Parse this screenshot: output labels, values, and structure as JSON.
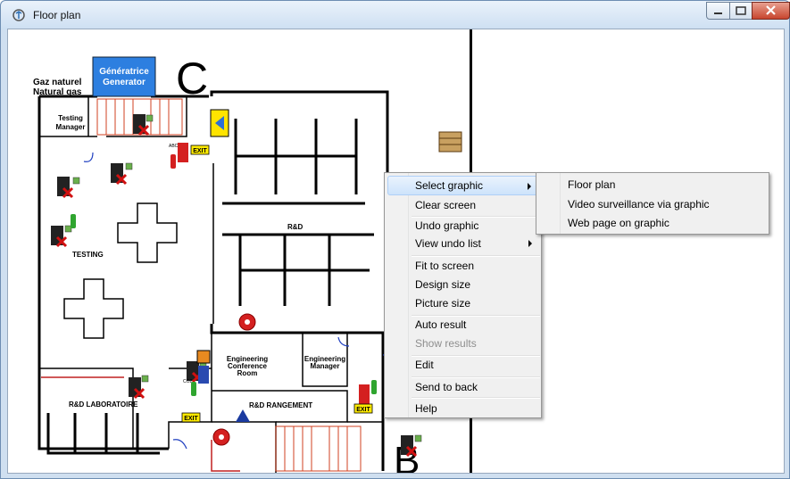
{
  "window": {
    "title": "Floor plan"
  },
  "floorplan": {
    "gas_label": "Gaz naturel",
    "gas_label_en": "Natural gas",
    "generator_fr": "Génératrice",
    "generator_en": "Generator",
    "building_c": "C",
    "building_b": "B",
    "testing_manager_1": "Testing",
    "testing_manager_2": "Manager",
    "testing": "TESTING",
    "rnd": "R&D",
    "eng_conf_1": "Engineering",
    "eng_conf_2": "Conference",
    "eng_conf_3": "Room",
    "eng_mgr_1": "Engineering",
    "eng_mgr_2": "Manager",
    "rnd_lab": "R&D LABORATOIRE",
    "rnd_rangement": "R&D RANGEMENT",
    "exit": "EXIT",
    "abc": "ABC",
    "co2": "CO2"
  },
  "context_menu": {
    "items": [
      {
        "label": "Select graphic",
        "submenu": true,
        "highlighted": true,
        "enabled": true
      },
      {
        "label": "Clear screen",
        "enabled": true
      },
      {
        "label": "Undo graphic",
        "enabled": true
      },
      {
        "label": "View undo list",
        "submenu": true,
        "enabled": true
      },
      {
        "label": "Fit to screen",
        "enabled": true
      },
      {
        "label": "Design size",
        "enabled": true
      },
      {
        "label": "Picture size",
        "enabled": true
      },
      {
        "label": "Auto result",
        "enabled": true
      },
      {
        "label": "Show results",
        "enabled": false
      },
      {
        "label": "Edit",
        "enabled": true
      },
      {
        "label": "Send to back",
        "enabled": true
      },
      {
        "label": "Help",
        "enabled": true
      }
    ]
  },
  "submenu": {
    "items": [
      {
        "label": "Floor plan"
      },
      {
        "label": "Video surveillance via graphic"
      },
      {
        "label": "Web page on graphic"
      }
    ]
  },
  "colors": {
    "generator": "#2d7fe0",
    "highlight": "#cde3fb",
    "exit": "#ffeb00",
    "extinguisher_red": "#d42020",
    "extinguisher_green": "#2fa52f"
  }
}
